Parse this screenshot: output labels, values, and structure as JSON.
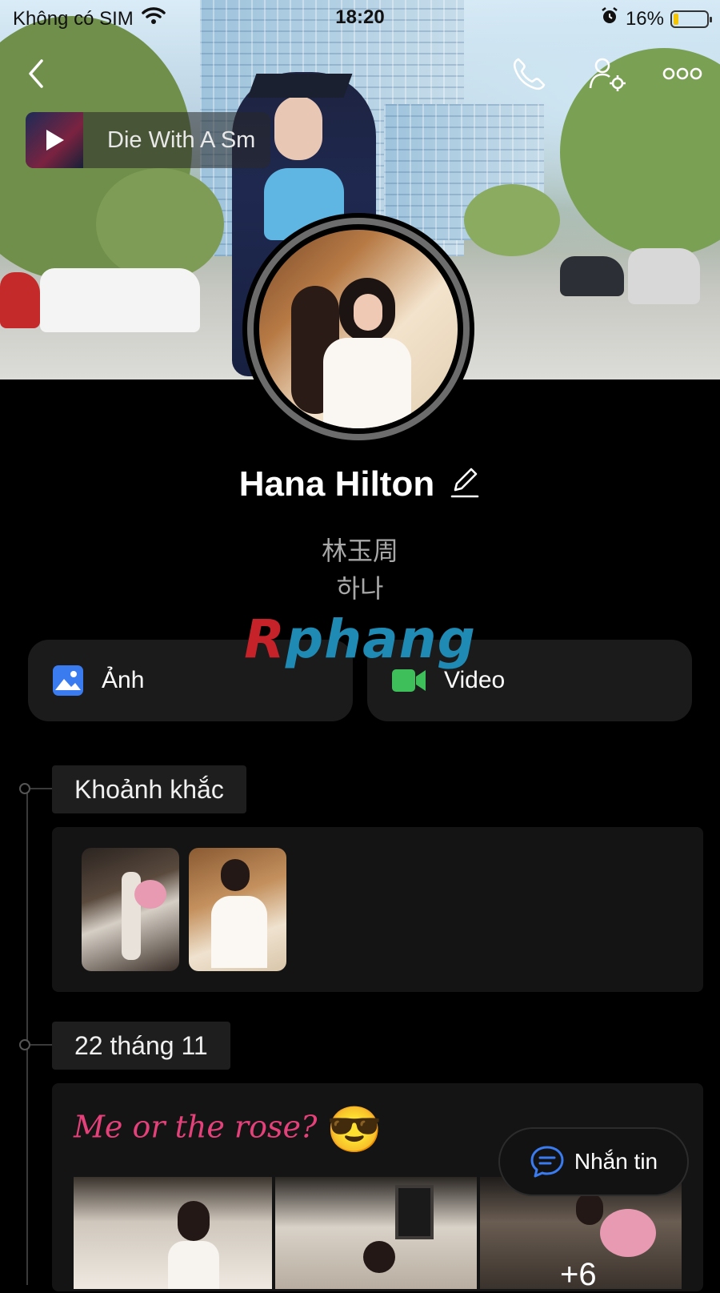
{
  "status_bar": {
    "carrier": "Không có SIM",
    "time": "18:20",
    "battery_percent": "16%",
    "battery_level": 0.16
  },
  "music": {
    "song_title": "Die With A Sm"
  },
  "profile": {
    "name": "Hana Hilton",
    "alias_line1": "林玉周",
    "alias_line2": "하나"
  },
  "watermark": {
    "first": "R",
    "rest": "phang"
  },
  "media": {
    "photos_label": "Ảnh",
    "video_label": "Video"
  },
  "timeline": {
    "moments_label": "Khoảnh khắc",
    "post_date": "22 tháng 11",
    "post_caption": "Me or the rose?",
    "post_emoji": "😎",
    "more_count": "+6"
  },
  "fab": {
    "label": "Nhắn tin"
  },
  "colors": {
    "accent_blue": "#3a7bf0",
    "video_green": "#3fbf5a",
    "caption_pink": "#e4417a",
    "battery_yellow": "#f5c400"
  },
  "icons": {
    "back": "chevron-left-icon",
    "call": "phone-icon",
    "settings": "user-settings-icon",
    "more": "more-dots-icon",
    "photos": "image-icon",
    "video": "video-camera-icon",
    "edit": "pencil-icon",
    "message": "chat-bubble-icon",
    "play": "play-icon"
  }
}
